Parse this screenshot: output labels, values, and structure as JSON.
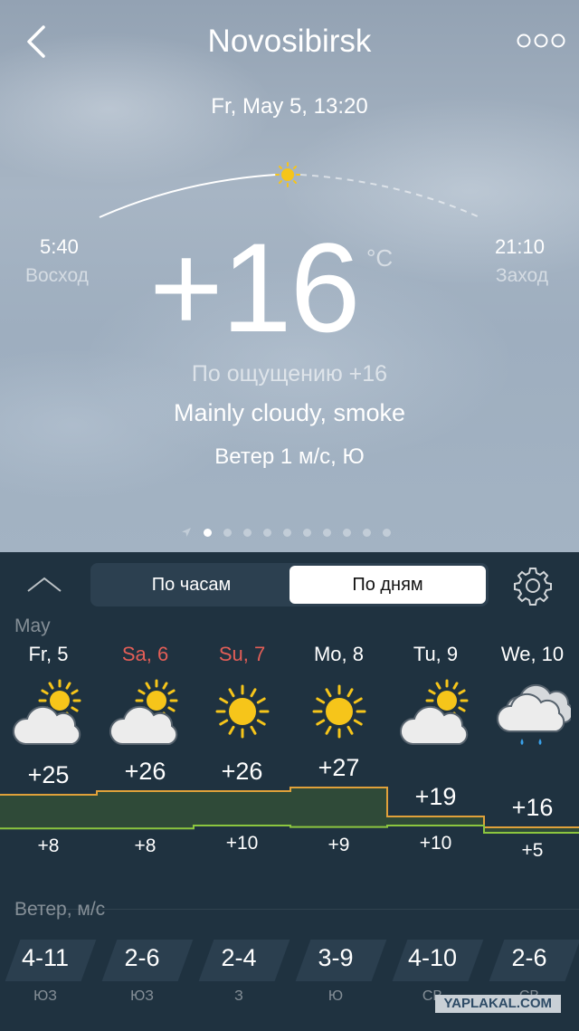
{
  "header": {
    "city": "Novosibirsk",
    "datetime": "Fr, May 5, 13:20"
  },
  "icons": {
    "back": "chevron-left-icon",
    "more": "more-dots-icon",
    "sun": "sun-icon",
    "settings": "gear-icon",
    "collapse": "chevron-up-icon",
    "location": "location-arrow-icon"
  },
  "current": {
    "sunrise_time": "5:40",
    "sunrise_label": "Восход",
    "sunset_time": "21:10",
    "sunset_label": "Заход",
    "temperature": "+16",
    "unit": "°C",
    "feels_like": "По ощущению +16",
    "condition": "Mainly cloudy, smoke",
    "wind": "Ветер 1 м/с, Ю"
  },
  "pager": {
    "count": 10,
    "active_index": 0
  },
  "tabs": [
    {
      "label": "По часам",
      "active": false
    },
    {
      "label": "По дням",
      "active": true
    }
  ],
  "forecast": {
    "month": "May",
    "days": [
      {
        "label": "Fr, 5",
        "weekend": false,
        "icon": "partly-cloudy-icon",
        "max": "+25",
        "min": "+8",
        "wind": "4-11",
        "dir": "ЮЗ"
      },
      {
        "label": "Sa, 6",
        "weekend": true,
        "icon": "partly-cloudy-icon",
        "max": "+26",
        "min": "+8",
        "wind": "2-6",
        "dir": "ЮЗ"
      },
      {
        "label": "Su, 7",
        "weekend": true,
        "icon": "sun-icon",
        "max": "+26",
        "min": "+10",
        "wind": "2-4",
        "dir": "З"
      },
      {
        "label": "Mo, 8",
        "weekend": false,
        "icon": "sun-icon",
        "max": "+27",
        "min": "+9",
        "wind": "3-9",
        "dir": "Ю"
      },
      {
        "label": "Tu, 9",
        "weekend": false,
        "icon": "partly-cloudy-icon",
        "max": "+19",
        "min": "+10",
        "wind": "4-10",
        "dir": "СВ"
      },
      {
        "label": "We, 10",
        "weekend": false,
        "icon": "rain-cloud-icon",
        "max": "+16",
        "min": "+5",
        "wind": "2-6",
        "dir": "СВ"
      }
    ],
    "wind_title": "Ветер, м/с"
  },
  "watermark": "YAPLAKAL.COM",
  "colors": {
    "panel": "#1f3240",
    "weekend": "#e25e57",
    "max_line": "#e0a13a",
    "min_line": "#8cc63f",
    "band": "#2f4a38",
    "sun": "#f6c51a"
  }
}
